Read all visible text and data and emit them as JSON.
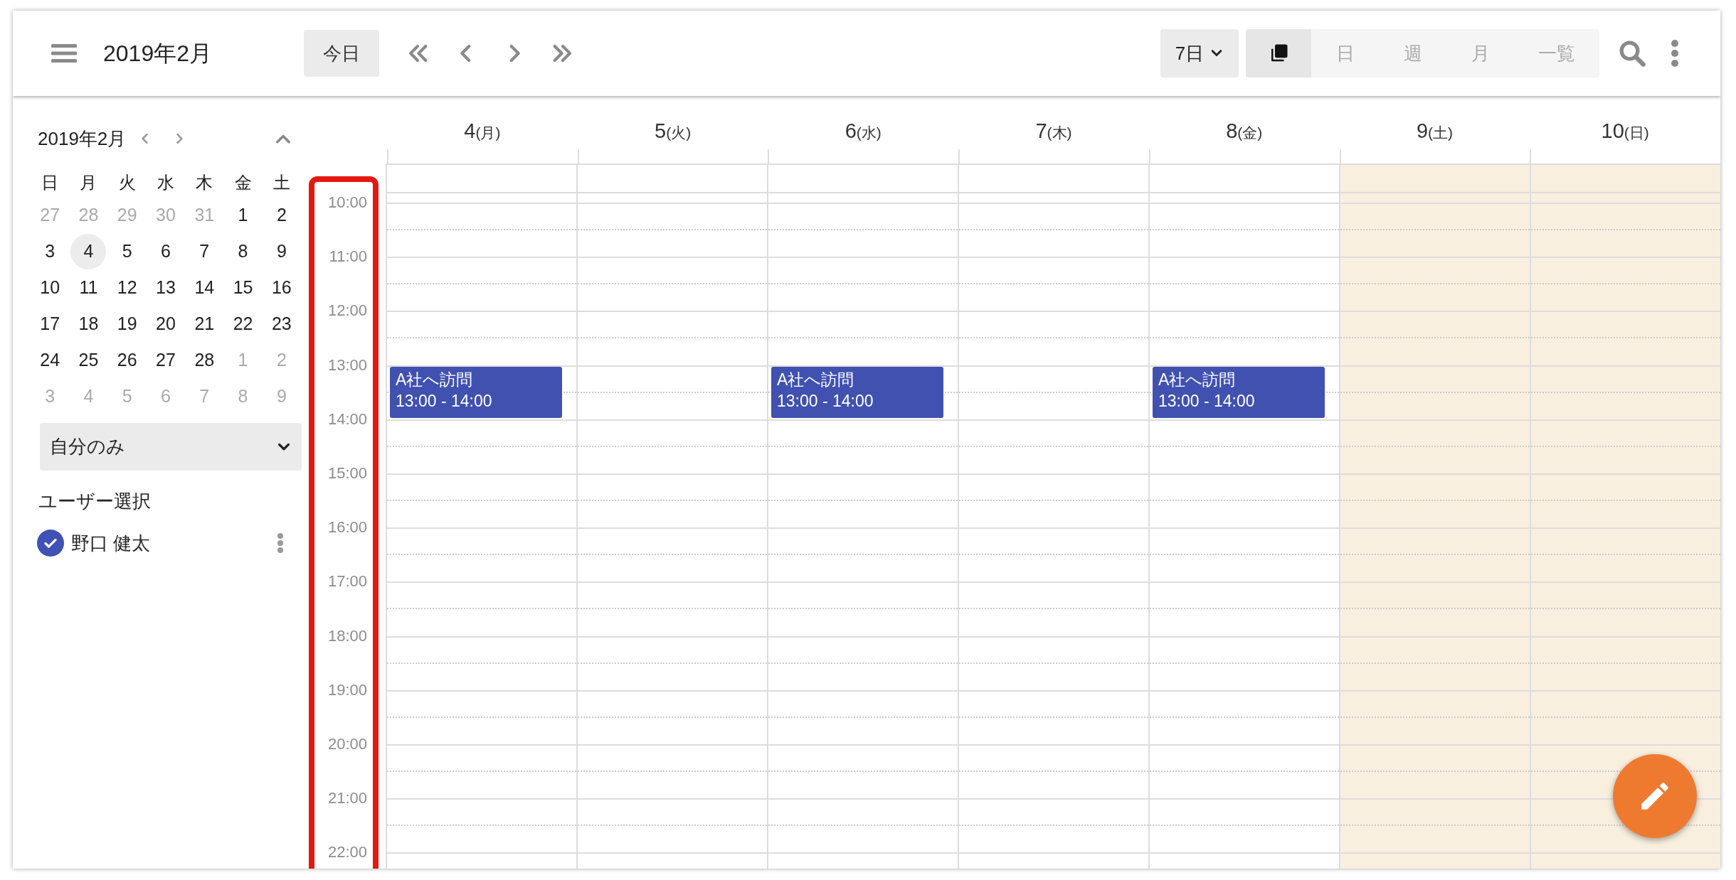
{
  "header": {
    "title": "2019年2月",
    "today_button": "今日",
    "range_select": "7日",
    "views": [
      {
        "kind": "icon",
        "selected": true
      },
      {
        "kind": "text",
        "label": "日",
        "selected": false
      },
      {
        "kind": "text",
        "label": "週",
        "selected": false
      },
      {
        "kind": "text",
        "label": "月",
        "selected": false
      },
      {
        "kind": "text",
        "label": "一覧",
        "selected": false
      }
    ]
  },
  "mini_calendar": {
    "title": "2019年2月",
    "weekdays": [
      "日",
      "月",
      "火",
      "水",
      "木",
      "金",
      "土"
    ],
    "weeks": [
      [
        {
          "day": "27",
          "muted": true,
          "selected": false
        },
        {
          "day": "28",
          "muted": true,
          "selected": false
        },
        {
          "day": "29",
          "muted": true,
          "selected": false
        },
        {
          "day": "30",
          "muted": true,
          "selected": false
        },
        {
          "day": "31",
          "muted": true,
          "selected": false
        },
        {
          "day": "1",
          "muted": false,
          "selected": false
        },
        {
          "day": "2",
          "muted": false,
          "selected": false
        }
      ],
      [
        {
          "day": "3",
          "muted": false,
          "selected": false
        },
        {
          "day": "4",
          "muted": false,
          "selected": true
        },
        {
          "day": "5",
          "muted": false,
          "selected": false
        },
        {
          "day": "6",
          "muted": false,
          "selected": false
        },
        {
          "day": "7",
          "muted": false,
          "selected": false
        },
        {
          "day": "8",
          "muted": false,
          "selected": false
        },
        {
          "day": "9",
          "muted": false,
          "selected": false
        }
      ],
      [
        {
          "day": "10",
          "muted": false,
          "selected": false
        },
        {
          "day": "11",
          "muted": false,
          "selected": false
        },
        {
          "day": "12",
          "muted": false,
          "selected": false
        },
        {
          "day": "13",
          "muted": false,
          "selected": false
        },
        {
          "day": "14",
          "muted": false,
          "selected": false
        },
        {
          "day": "15",
          "muted": false,
          "selected": false
        },
        {
          "day": "16",
          "muted": false,
          "selected": false
        }
      ],
      [
        {
          "day": "17",
          "muted": false,
          "selected": false
        },
        {
          "day": "18",
          "muted": false,
          "selected": false
        },
        {
          "day": "19",
          "muted": false,
          "selected": false
        },
        {
          "day": "20",
          "muted": false,
          "selected": false
        },
        {
          "day": "21",
          "muted": false,
          "selected": false
        },
        {
          "day": "22",
          "muted": false,
          "selected": false
        },
        {
          "day": "23",
          "muted": false,
          "selected": false
        }
      ],
      [
        {
          "day": "24",
          "muted": false,
          "selected": false
        },
        {
          "day": "25",
          "muted": false,
          "selected": false
        },
        {
          "day": "26",
          "muted": false,
          "selected": false
        },
        {
          "day": "27",
          "muted": false,
          "selected": false
        },
        {
          "day": "28",
          "muted": false,
          "selected": false
        },
        {
          "day": "1",
          "muted": true,
          "selected": false
        },
        {
          "day": "2",
          "muted": true,
          "selected": false
        }
      ],
      [
        {
          "day": "3",
          "muted": true,
          "selected": false
        },
        {
          "day": "4",
          "muted": true,
          "selected": false
        },
        {
          "day": "5",
          "muted": true,
          "selected": false
        },
        {
          "day": "6",
          "muted": true,
          "selected": false
        },
        {
          "day": "7",
          "muted": true,
          "selected": false
        },
        {
          "day": "8",
          "muted": true,
          "selected": false
        },
        {
          "day": "9",
          "muted": true,
          "selected": false
        }
      ]
    ]
  },
  "filter_select": "自分のみ",
  "user_section": {
    "title": "ユーザー選択",
    "users": [
      {
        "name": "野口 健太",
        "checked": true
      }
    ]
  },
  "hours": [
    "10:00",
    "11:00",
    "12:00",
    "13:00",
    "14:00",
    "15:00",
    "16:00",
    "17:00",
    "18:00",
    "19:00",
    "20:00",
    "21:00",
    "22:00"
  ],
  "days": [
    {
      "date": "4",
      "weekday": "(月)",
      "weekend": false,
      "events": [
        {
          "title": "A社へ訪問",
          "time": "13:00 - 14:00"
        }
      ]
    },
    {
      "date": "5",
      "weekday": "(火)",
      "weekend": false
    },
    {
      "date": "6",
      "weekday": "(水)",
      "weekend": false,
      "events": [
        {
          "title": "A社へ訪問",
          "time": "13:00 - 14:00"
        }
      ]
    },
    {
      "date": "7",
      "weekday": "(木)",
      "weekend": false
    },
    {
      "date": "8",
      "weekday": "(金)",
      "weekend": false,
      "events": [
        {
          "title": "A社へ訪問",
          "time": "13:00 - 14:00"
        }
      ]
    },
    {
      "date": "9",
      "weekday": "(土)",
      "weekend": true
    },
    {
      "date": "10",
      "weekday": "(日)",
      "weekend": true
    }
  ]
}
